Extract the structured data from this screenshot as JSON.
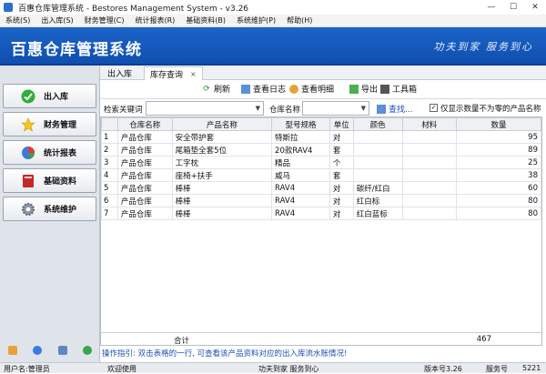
{
  "window": {
    "title": "百惠仓库管理系统 - Bestores Management System - v3.26",
    "minimize": "—",
    "maximize": "☐",
    "close": "✕"
  },
  "menu": [
    "系统(S)",
    "出入库(S)",
    "财务管理(C)",
    "统计报表(R)",
    "基础资料(B)",
    "系统维护(P)",
    "帮助(H)"
  ],
  "banner": {
    "title": "百惠仓库管理系统",
    "slogan": "功夫到家  服务到心"
  },
  "nav": [
    {
      "label": "出入库",
      "icon": "check-icon"
    },
    {
      "label": "财务管理",
      "icon": "star-icon"
    },
    {
      "label": "统计报表",
      "icon": "pie-chart-icon"
    },
    {
      "label": "基础资料",
      "icon": "book-icon"
    },
    {
      "label": "系统维护",
      "icon": "gear-icon"
    }
  ],
  "tabs": [
    {
      "label": "出入库"
    },
    {
      "label": "库存查询",
      "close": "×"
    }
  ],
  "toolbar": {
    "refresh": "刷新",
    "view_log": "查看日志",
    "view_detail": "查看明细",
    "export": "导出",
    "toolbox": "工具箱"
  },
  "search": {
    "keyword_label": "检索关键词",
    "keyword_value": "",
    "warehouse_label": "仓库名称",
    "warehouse_value": "",
    "find_label": "查找...",
    "nonzero_checked": true,
    "nonzero_label": "仅显示数量不为零的产品名称"
  },
  "table": {
    "headers": [
      "",
      "仓库名称",
      "产品名称",
      "型号规格",
      "单位",
      "颜色",
      "材料",
      "数量"
    ],
    "rows": [
      [
        "1",
        "产品仓库",
        "安全带护套",
        "特斯拉",
        "对",
        "",
        "",
        "95"
      ],
      [
        "2",
        "产品仓库",
        "尾箱垫全套5位",
        "20款RAV4",
        "套",
        "",
        "",
        "89"
      ],
      [
        "3",
        "产品仓库",
        "工字枕",
        "精品",
        "个",
        "",
        "",
        "25"
      ],
      [
        "4",
        "产品仓库",
        "座椅+扶手",
        "威马",
        "套",
        "",
        "",
        "38"
      ],
      [
        "5",
        "产品仓库",
        "棒棒",
        "RAV4",
        "对",
        "碳纤/红白",
        "",
        "60"
      ],
      [
        "6",
        "产品仓库",
        "棒棒",
        "RAV4",
        "对",
        "红白标",
        "",
        "80"
      ],
      [
        "7",
        "产品仓库",
        "棒棒",
        "RAV4",
        "对",
        "红白蓝标",
        "",
        "80"
      ]
    ],
    "total_label": "合计",
    "total_value": "467"
  },
  "hint": "操作指引: 双击表格的一行, 可查看该产品资料对应的出入库流水账情况!",
  "status": {
    "user": "用户名:管理员",
    "welcome": "欢迎使用",
    "slogan": "功夫到家 服务到心",
    "version": "版本号3.26",
    "service": "服务号",
    "service_no": "5221"
  },
  "colors": {
    "banner": "#1c64c9",
    "link": "#1a4fb5"
  }
}
